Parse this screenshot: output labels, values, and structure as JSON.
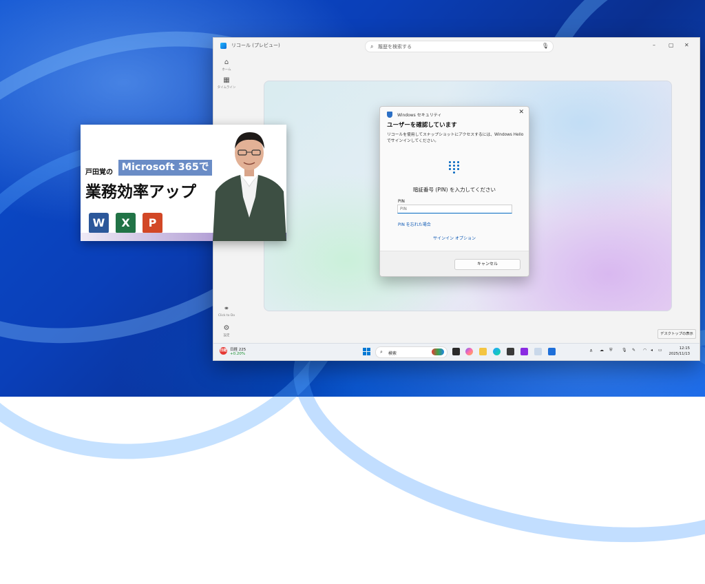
{
  "app": {
    "title": "リコール (プレビュー)",
    "search_placeholder": "履歴を検索する",
    "window_controls": {
      "minimize": "–",
      "maximize": "▢",
      "close": "✕"
    }
  },
  "sidebar": {
    "items": [
      {
        "label": "ホーム",
        "icon": "home-icon",
        "glyph": "⌂"
      },
      {
        "label": "タイムライン",
        "icon": "timeline-icon",
        "glyph": "▦"
      },
      {
        "label": "Click to Do",
        "icon": "click-to-do-icon",
        "glyph": "⚭"
      },
      {
        "label": "設定",
        "icon": "gear-icon",
        "glyph": "⚙"
      }
    ]
  },
  "dialog": {
    "app_name": "Windows セキュリティ",
    "heading": "ユーザーを確認しています",
    "description": "リコールを使用してスナップショットにアクセスするには、Windows Hello でサインインしてください。",
    "prompt": "暗証番号 (PIN) を入力してください",
    "pin_label": "PIN",
    "pin_placeholder": "PIN",
    "forgot_pin": "PIN を忘れた場合",
    "sign_in_options": "サインイン オプション",
    "cancel": "キャンセル",
    "close": "✕"
  },
  "taskbar": {
    "stock_name": "日経 225",
    "stock_change": "+0.20%",
    "stock_badge": "日経",
    "search_label": "検索",
    "tray_chevron": "∧",
    "time": "12:15",
    "date": "2025/11/13",
    "show_desktop": "デスクトップの表示"
  },
  "banner": {
    "author": "戸田覚の",
    "product": "Microsoft 365で",
    "title": "業務効率アップ",
    "apps": [
      "W",
      "X",
      "P"
    ],
    "app_colors": [
      "#2b579a",
      "#217346",
      "#d24726"
    ]
  },
  "colors": {
    "accent": "#0067c0",
    "link": "#0a56b3"
  }
}
